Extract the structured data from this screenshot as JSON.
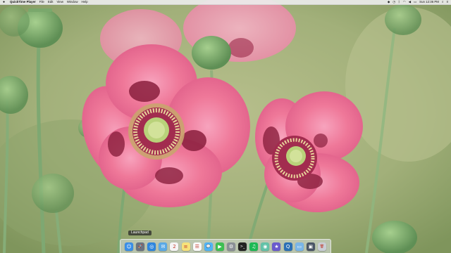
{
  "menubar": {
    "app_name": "QuickTime Player",
    "menus": [
      "File",
      "Edit",
      "View",
      "Window",
      "Help"
    ],
    "clock": "Sun 12:36 PM"
  },
  "dock": {
    "tooltip": "Launchpad",
    "items": [
      {
        "icon": "finder-icon",
        "color": "#3a8ee6",
        "glyph": "☺"
      },
      {
        "icon": "launchpad-icon",
        "color": "#6b7380",
        "glyph": "🚀"
      },
      {
        "icon": "safari-icon",
        "color": "#2e86de",
        "glyph": "◎"
      },
      {
        "icon": "mail-icon",
        "color": "#5aa9e6",
        "glyph": "✉"
      },
      {
        "icon": "calendar-icon",
        "color": "#f5f5f5",
        "glyph": "2"
      },
      {
        "icon": "notes-icon",
        "color": "#f7e27a",
        "glyph": "≡"
      },
      {
        "icon": "reminders-icon",
        "color": "#fafafa",
        "glyph": "☰"
      },
      {
        "icon": "messages-icon",
        "color": "#4fb3f5",
        "glyph": "💬"
      },
      {
        "icon": "facetime-icon",
        "color": "#3dbf52",
        "glyph": "▶"
      },
      {
        "icon": "system-preferences-icon",
        "color": "#8a8f96",
        "glyph": "⚙"
      },
      {
        "icon": "terminal-icon",
        "color": "#222222",
        "glyph": ">_"
      },
      {
        "icon": "spotify-icon",
        "color": "#1db954",
        "glyph": "♫"
      },
      {
        "icon": "app-icon",
        "color": "#63c2a8",
        "glyph": "◉"
      },
      {
        "icon": "imovie-icon",
        "color": "#6a5acd",
        "glyph": "★"
      },
      {
        "icon": "quicktime-icon",
        "color": "#2a6fb5",
        "glyph": "Q"
      },
      {
        "icon": "folder-icon",
        "color": "#7ab6e8",
        "glyph": "▭"
      },
      {
        "icon": "screenshot-icon",
        "color": "#4a5566",
        "glyph": "▣"
      },
      {
        "icon": "trash-icon",
        "color": "#c9ced6",
        "glyph": "🗑"
      }
    ]
  }
}
